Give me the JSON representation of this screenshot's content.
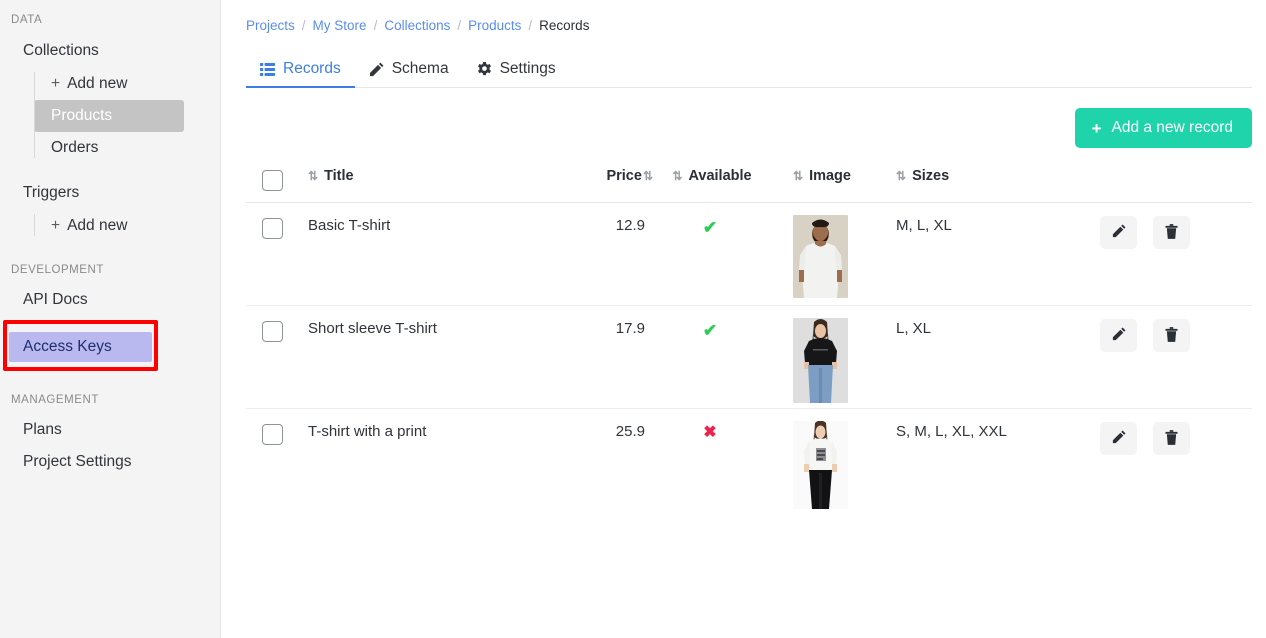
{
  "sidebar": {
    "sections": [
      {
        "label": "DATA"
      },
      {
        "label": "DEVELOPMENT"
      },
      {
        "label": "MANAGEMENT"
      }
    ],
    "collections_label": "Collections",
    "collections_children": [
      {
        "label": "Add new",
        "plus": "+"
      },
      {
        "label": "Products"
      },
      {
        "label": "Orders"
      }
    ],
    "triggers_label": "Triggers",
    "triggers_children": [
      {
        "label": "Add new",
        "plus": "+"
      }
    ],
    "development_items": [
      {
        "label": "API Docs"
      },
      {
        "label": "Access Keys"
      }
    ],
    "management_items": [
      {
        "label": "Plans"
      },
      {
        "label": "Project Settings"
      }
    ]
  },
  "breadcrumb": {
    "items": [
      {
        "label": "Projects",
        "link": true
      },
      {
        "label": "My Store",
        "link": true
      },
      {
        "label": "Collections",
        "link": true
      },
      {
        "label": "Products",
        "link": true
      },
      {
        "label": "Records",
        "link": false
      }
    ],
    "separator": "/"
  },
  "tabs": [
    {
      "label": "Records",
      "icon": "list-icon",
      "active": true
    },
    {
      "label": "Schema",
      "icon": "pencil-icon",
      "active": false
    },
    {
      "label": "Settings",
      "icon": "gear-icon",
      "active": false
    }
  ],
  "toolbar": {
    "add_record_label": "Add a new record",
    "add_record_plus": "+"
  },
  "table": {
    "columns": [
      {
        "key": "title",
        "label": "Title",
        "sortable": true,
        "sort_icon": "⇅",
        "icon_position": "before"
      },
      {
        "key": "price",
        "label": "Price",
        "sortable": true,
        "sort_icon": "⇅",
        "icon_position": "after"
      },
      {
        "key": "available",
        "label": "Available",
        "sortable": true,
        "sort_icon": "⇅",
        "icon_position": "before"
      },
      {
        "key": "image",
        "label": "Image",
        "sortable": true,
        "sort_icon": "⇅",
        "icon_position": "before"
      },
      {
        "key": "sizes",
        "label": "Sizes",
        "sortable": true,
        "sort_icon": "⇅",
        "icon_position": "before"
      }
    ],
    "rows": [
      {
        "title": "Basic T-shirt",
        "price": "12.9",
        "available": true,
        "available_mark": "✔",
        "image_alt": "man-in-white-tshirt-photo",
        "sizes": "M, L, XL"
      },
      {
        "title": "Short sleeve T-shirt",
        "price": "17.9",
        "available": true,
        "available_mark": "✔",
        "image_alt": "woman-in-black-tshirt-photo",
        "sizes": "L, XL"
      },
      {
        "title": "T-shirt with a print",
        "price": "25.9",
        "available": false,
        "available_mark": "✖",
        "image_alt": "woman-in-printed-tshirt-photo",
        "sizes": "S, M, L, XL, XXL"
      }
    ],
    "row_actions": {
      "edit_icon": "pencil-icon",
      "delete_icon": "trash-icon"
    }
  },
  "colors": {
    "accent_teal": "#1fd4ab",
    "link_blue": "#5b8def",
    "tab_active_blue": "#3c7fe0",
    "available_yes": "#2ecc55",
    "available_no": "#f0234d",
    "sidebar_bg": "#f4f4f4",
    "highlight_bg": "#b9b9f0",
    "annotation_red": "#ff0000"
  }
}
